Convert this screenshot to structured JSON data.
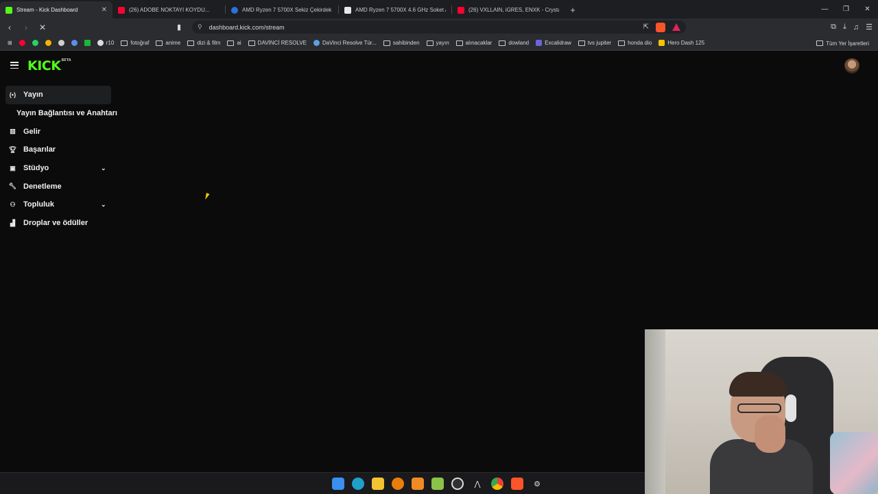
{
  "browser": {
    "tabs": [
      {
        "title": "Stream - Kick Dashboard",
        "favicon_color": "#53fc18",
        "active": true
      },
      {
        "title": "(26) ADOBE NOKTAYI KOYDU...",
        "favicon_color": "#ff0033",
        "active": false
      },
      {
        "title": "AMD Ryzen 7 5700X Sekiz Çekirdek",
        "favicon_color": "#2f6fdb",
        "active": false
      },
      {
        "title": "AMD Ryzen 7 5700X 4.6 GHz Soket A",
        "favicon_color": "#e8e8e8",
        "active": false
      },
      {
        "title": "(26) VXLLAIN, iGRES, ENXK - Crystal",
        "favicon_color": "#ff0033",
        "active": false
      }
    ],
    "url": "dashboard.kick.com/stream",
    "bookmarks": [
      {
        "label": "r10",
        "type": "site"
      },
      {
        "label": "fotoğraf",
        "type": "folder"
      },
      {
        "label": "anime",
        "type": "folder"
      },
      {
        "label": "dizi & film",
        "type": "folder"
      },
      {
        "label": "ai",
        "type": "folder"
      },
      {
        "label": "DAVİNCİ RESOLVE",
        "type": "folder"
      },
      {
        "label": "DaVinci Resolve Tür...",
        "type": "site"
      },
      {
        "label": "sahibinden",
        "type": "folder"
      },
      {
        "label": "yayın",
        "type": "folder"
      },
      {
        "label": "alınacaklar",
        "type": "folder"
      },
      {
        "label": "dowland",
        "type": "folder"
      },
      {
        "label": "Excalidraw",
        "type": "site"
      },
      {
        "label": "tvs jupiter",
        "type": "folder"
      },
      {
        "label": "honda dio",
        "type": "folder"
      },
      {
        "label": "Hero Dash 125",
        "type": "site"
      }
    ],
    "all_bookmarks_label": "Tüm Yer İşaretleri"
  },
  "kick": {
    "logo_text": "KICK",
    "logo_badge": "BETA",
    "brand_color": "#53fc18",
    "sidebar": [
      {
        "label": "Yayın",
        "icon": "broadcast-icon",
        "active": true,
        "expandable": false
      },
      {
        "label": "Yayın Bağlantısı ve Anahtarı",
        "sub": true
      },
      {
        "label": "Gelir",
        "icon": "chart-icon",
        "expandable": false
      },
      {
        "label": "Başarılar",
        "icon": "trophy-icon",
        "expandable": false
      },
      {
        "label": "Stüdyo",
        "icon": "studio-icon",
        "expandable": true
      },
      {
        "label": "Denetleme",
        "icon": "wrench-icon",
        "expandable": false
      },
      {
        "label": "Topluluk",
        "icon": "community-icon",
        "expandable": true
      },
      {
        "label": "Droplar ve ödüller",
        "icon": "gift-icon",
        "expandable": false
      }
    ]
  }
}
